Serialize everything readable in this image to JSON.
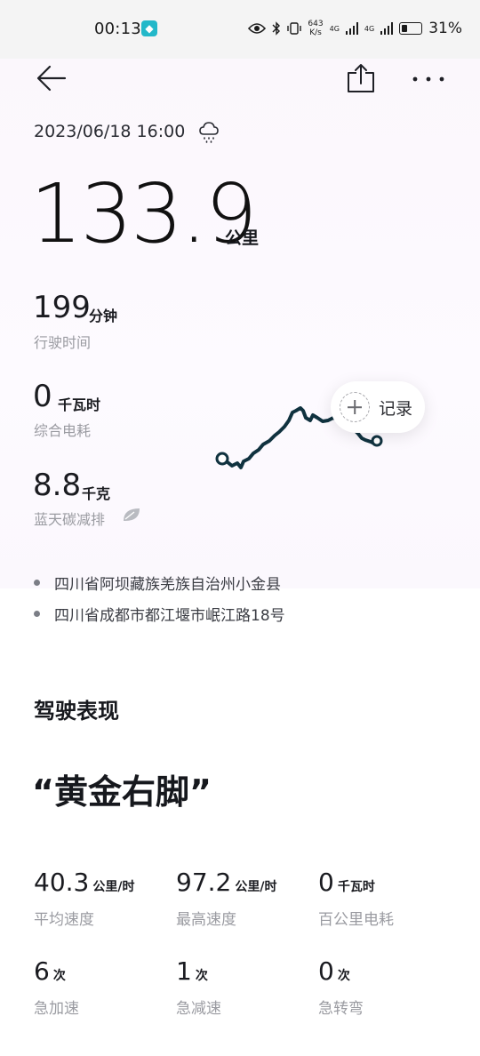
{
  "status_bar": {
    "time": "00:13",
    "net_speed_value": "643",
    "net_speed_unit": "K/s",
    "signal_1": "4G",
    "signal_2": "4G",
    "battery_level": 0.31,
    "battery_percent": "31%"
  },
  "trip": {
    "datetime": "2023/06/18 16:00",
    "weather_icon": "rain-cloud-icon",
    "distance": "133.9",
    "distance_unit": "公里",
    "duration_value": "199",
    "duration_unit": "分钟",
    "duration_label": "行驶时间",
    "energy_value": "0",
    "energy_unit": "千瓦时",
    "energy_label": "综合电耗",
    "carbon_value": "8.8",
    "carbon_unit": "千克",
    "carbon_label": "蓝天碳减排",
    "record_label": "记录"
  },
  "addresses": [
    "四川省阿坝藏族羌族自治州小金县",
    "四川省成都市都江堰市岷江路18号"
  ],
  "performance": {
    "title": "驾驶表现",
    "quote": "“黄金右脚”",
    "metrics": [
      {
        "value": "40.3",
        "unit": "公里/时",
        "label": "平均速度"
      },
      {
        "value": "97.2",
        "unit": "公里/时",
        "label": "最高速度"
      },
      {
        "value": "0",
        "unit": "千瓦时",
        "label": "百公里电耗"
      },
      {
        "value": "6",
        "unit": "次",
        "label": "急加速"
      },
      {
        "value": "1",
        "unit": "次",
        "label": "急减速"
      },
      {
        "value": "0",
        "unit": "次",
        "label": "急转弯"
      }
    ]
  },
  "colors": {
    "route": "#10323f",
    "accent_badge": "#23b8c9"
  }
}
